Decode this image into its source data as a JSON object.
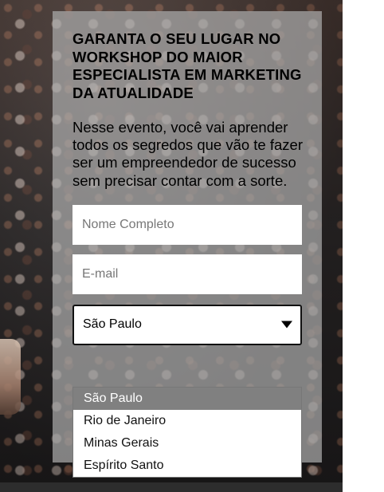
{
  "hero": {
    "title": "GARANTA O SEU LUGAR NO WORKSHOP DO MAIOR ESPECIALISTA EM MARKETING DA ATUALIDADE",
    "description": "Nesse evento, você vai aprender todos os segredos que vão te fazer ser um empreendedor de sucesso sem precisar contar com a sorte."
  },
  "form": {
    "name_placeholder": "Nome Completo",
    "email_placeholder": "E-mail",
    "state_select": {
      "selected": "São Paulo",
      "options": [
        "São Paulo",
        "Rio de Janeiro",
        "Minas Gerais",
        "Espírito Santo"
      ],
      "selected_index": 0
    }
  },
  "colors": {
    "panel": "#aaaaaa",
    "selected_option": "#808080"
  },
  "icons": {
    "select_arrow": "triangle-down-icon"
  }
}
